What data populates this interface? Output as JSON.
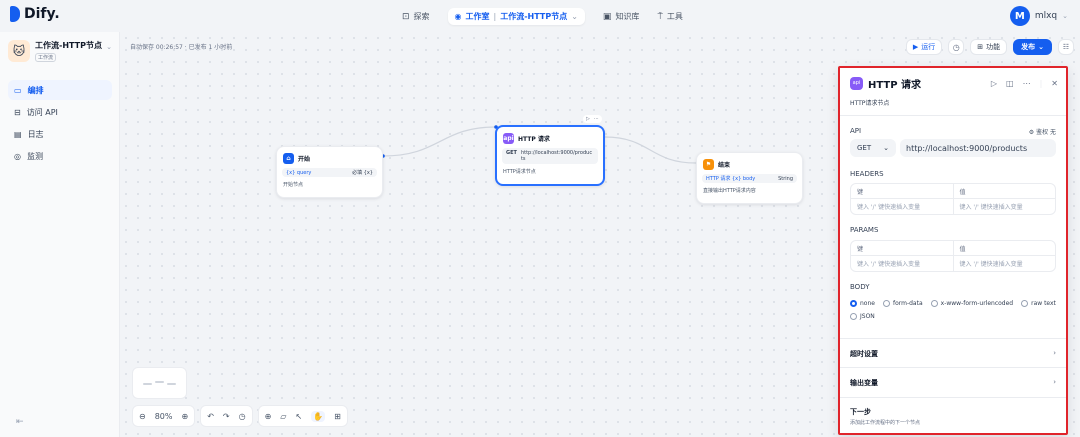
{
  "brand": {
    "name": "Dify."
  },
  "nav": {
    "explore": "探索",
    "studio": "工作室",
    "current_app": "工作流-HTTP节点",
    "knowledge": "知识库",
    "tools": "工具"
  },
  "user": {
    "initial": "M",
    "name": "mlxq"
  },
  "sidebar": {
    "app_name": "工作流-HTTP节点",
    "app_type": "工作流",
    "items": [
      {
        "label": "编排",
        "icon": "layout-icon",
        "active": true
      },
      {
        "label": "访问 API",
        "icon": "terminal-icon",
        "active": false
      },
      {
        "label": "日志",
        "icon": "file-icon",
        "active": false
      },
      {
        "label": "监测",
        "icon": "monitor-icon",
        "active": false
      }
    ]
  },
  "canvas": {
    "autosave": "自动保存 00:26:57 · 已发布 1 小时前",
    "run_label": "运行",
    "features_label": "功能",
    "publish_label": "发布"
  },
  "nodes": {
    "start": {
      "title": "开始",
      "var_name": "{x} query",
      "var_type": "必填 {x}",
      "desc": "开始节点"
    },
    "http": {
      "title": "HTTP 请求",
      "method": "GET",
      "url": "http://localhost:9000/products",
      "desc": "HTTP请求节点"
    },
    "end": {
      "title": "结束",
      "var_name": "HTTP 请求 {x} body",
      "var_type": "String",
      "desc": "直接输出HTTP请求内容"
    }
  },
  "controls": {
    "zoom": "80%"
  },
  "panel": {
    "title": "HTTP 请求",
    "desc": "HTTP请求节点",
    "api_label": "API",
    "auth_label": "鉴权 无",
    "method": "GET",
    "url": "http://localhost:9000/products",
    "headers_label": "HEADERS",
    "params_label": "PARAMS",
    "key_header": "键",
    "value_header": "值",
    "key_placeholder": "键入 '/' 键快速插入变量",
    "value_placeholder": "键入 '/' 键快速插入变量",
    "body_label": "BODY",
    "body_options": [
      "none",
      "form-data",
      "x-www-form-urlencoded",
      "raw text",
      "JSON"
    ],
    "body_selected": "none",
    "timeout_label": "超时设置",
    "output_label": "输出变量",
    "next_title": "下一步",
    "next_desc": "添加此工作流程中的下一个节点"
  },
  "colors": {
    "accent": "#155eef",
    "http_icon": "#875bf7",
    "start_icon": "#155eef",
    "end_icon": "#f79009",
    "highlight": "#e0242b"
  }
}
